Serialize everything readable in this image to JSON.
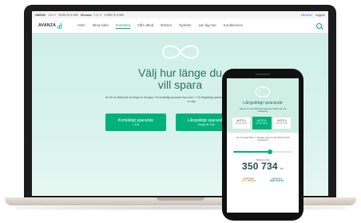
{
  "ticker": {
    "items": [
      {
        "label": "OMXS30",
        "value": "2.45 %",
        "extra": "78 993,75 % SEK"
      },
      {
        "label": "Ericsson",
        "value": "2.11 %",
        "extra": "74 993,75 % SEK"
      }
    ],
    "links": [
      "Mitt konto",
      "Logga in"
    ]
  },
  "nav": {
    "logo": "AVANZA",
    "items": [
      "Hem",
      "Mina sidor",
      "Investera",
      "Vårt utbud",
      "Börsen",
      "Nyheter",
      "Lär dig mer",
      "Kundservice"
    ],
    "active_index": 2
  },
  "hero": {
    "title_line1": "Välj hur länge du",
    "title_line2": "vill spara",
    "text": "Hur för du tillväxt på hur länge du vill spara. För kortsiktigt sparande finns Auto 1. För långsiktigt sparande Auto 4-6. Dina pengar är självklart alltid lätta på en dag.",
    "buttons": [
      {
        "label": "Kortsiktigt sparande",
        "sub": "< 5 år"
      },
      {
        "label": "Långsiktigt sparande",
        "sub": "Längre än 5 år"
      }
    ]
  },
  "phone": {
    "title": "Långsiktigt sparande",
    "subtitle": "Välj hur du vill fördela ditt sparande mellan risk och avkastning",
    "tabs": [
      {
        "label": "AUTO 4",
        "sub": "För dig i 35 år"
      },
      {
        "label": "AUTO 5",
        "sub": "För dig i 25 år"
      },
      {
        "label": "AUTO 6",
        "sub": "För dig i 15 år"
      }
    ],
    "active_tab": 1,
    "note": "Om du sparar 500 kr i månaden i Auto 5 under 25 år kan ditt sparande bli",
    "slider_fraction": 0.62,
    "result_label": "Beräknat värde",
    "amount": "350 734",
    "amount_unit": "kr",
    "stats": [
      {
        "label": "Insättningar",
        "value": "277 000 kr"
      },
      {
        "label": "Avkastning",
        "value": "408 019 kr"
      }
    ]
  },
  "colors": {
    "accent": "#00b27a",
    "hero_bg": "#d4f1e8",
    "title_text": "#2f6f63"
  }
}
